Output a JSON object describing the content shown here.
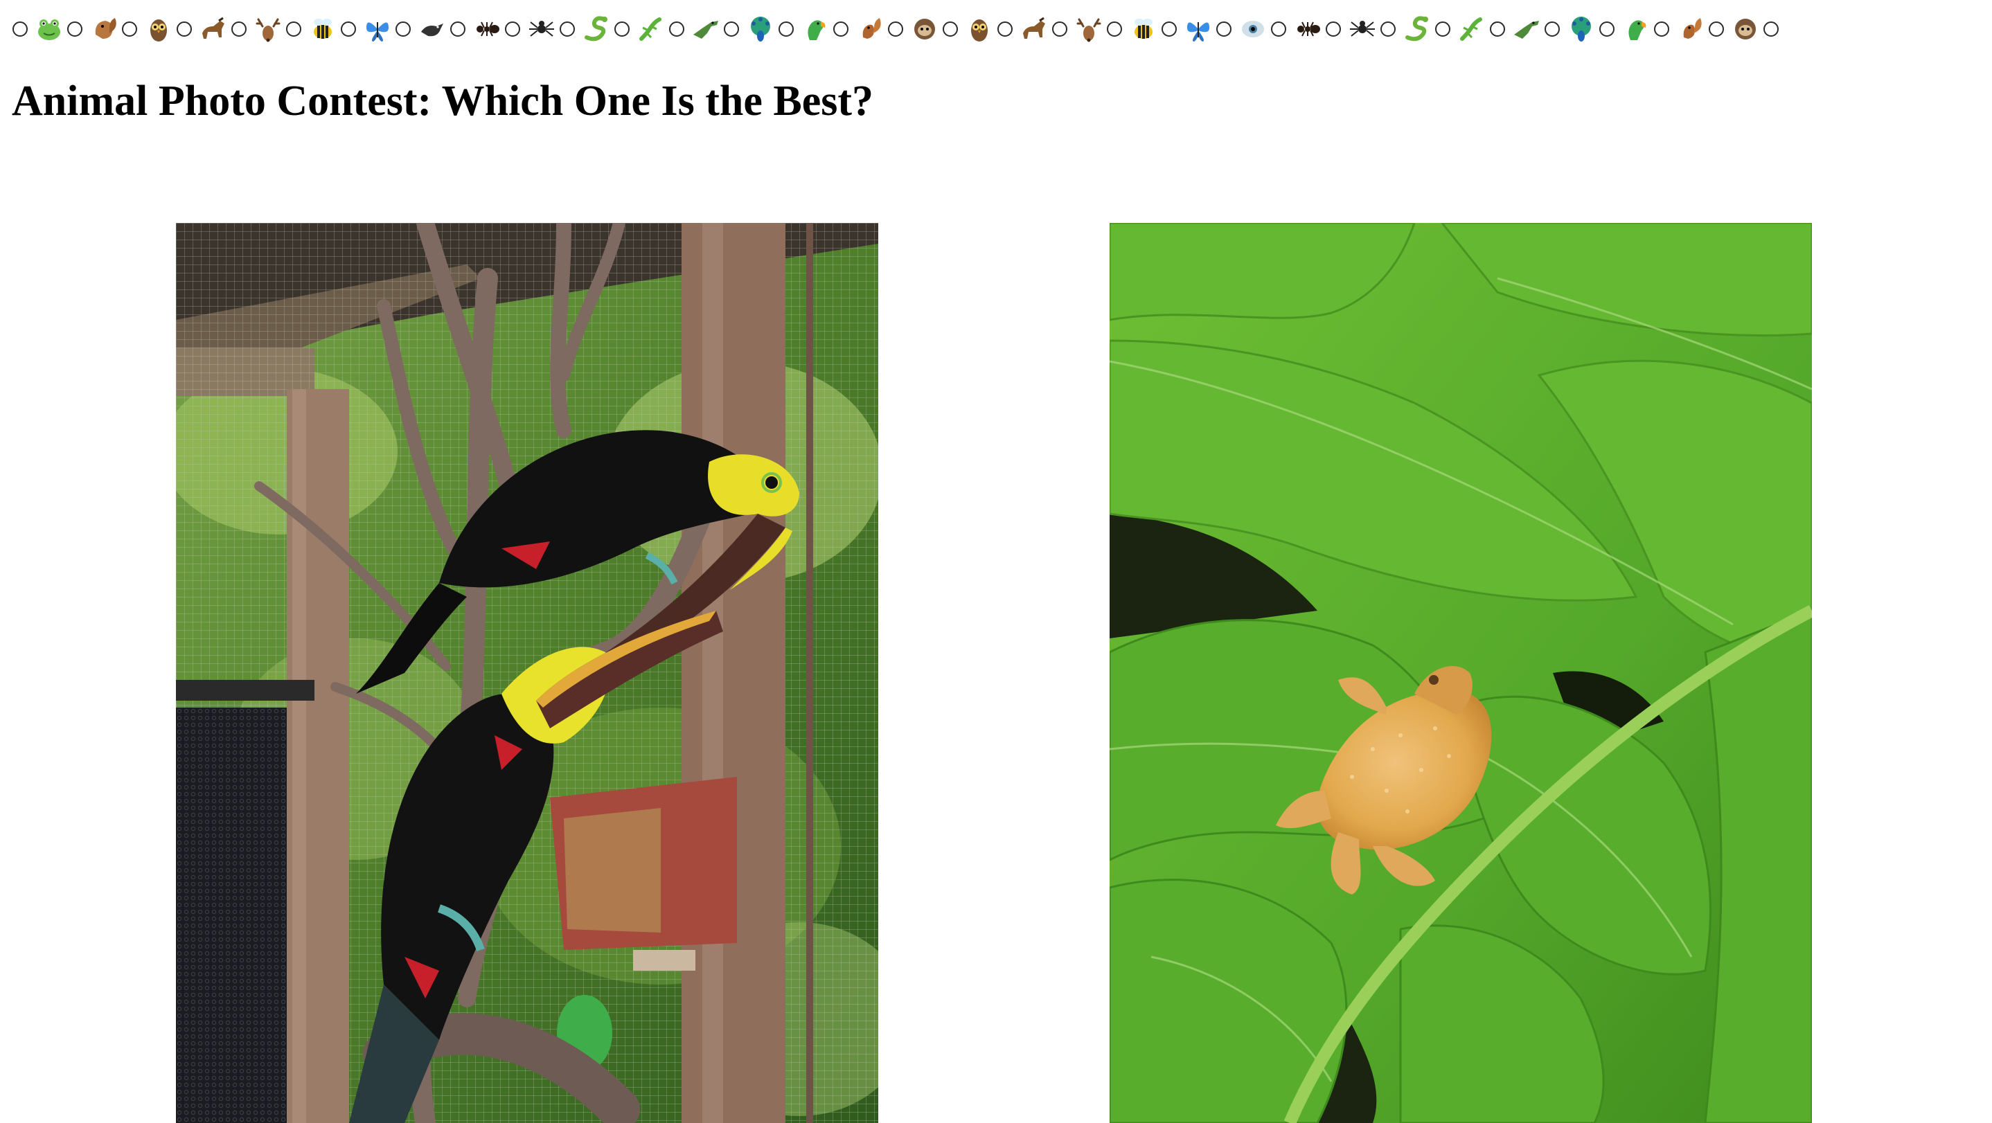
{
  "page": {
    "title": "Animal Photo Contest: Which One Is the Best?"
  },
  "emoji_options": [
    {
      "icon": "frog-icon",
      "glyph": "🐸"
    },
    {
      "icon": "chipmunk-icon",
      "glyph": "🐿"
    },
    {
      "icon": "owl-icon",
      "glyph": "🦉"
    },
    {
      "icon": "horse-icon",
      "glyph": "🐎"
    },
    {
      "icon": "deer-icon",
      "glyph": "🦌"
    },
    {
      "icon": "bee-icon",
      "glyph": "🐝"
    },
    {
      "icon": "butterfly-icon",
      "glyph": "🦋"
    },
    {
      "icon": "bird-icon",
      "glyph": "🐦"
    },
    {
      "icon": "ant-icon",
      "glyph": "🐜"
    },
    {
      "icon": "spider-icon",
      "glyph": "🕷"
    },
    {
      "icon": "snake-icon",
      "glyph": "🐍"
    },
    {
      "icon": "lizard-icon",
      "glyph": "🦎"
    },
    {
      "icon": "crocodile-icon",
      "glyph": "🐊"
    },
    {
      "icon": "peacock-icon",
      "glyph": "🦚"
    },
    {
      "icon": "parrot-icon",
      "glyph": "🦜"
    },
    {
      "icon": "squirrel-icon",
      "glyph": "🐿"
    },
    {
      "icon": "sloth-icon",
      "glyph": "🦥"
    },
    {
      "icon": "owl-icon",
      "glyph": "🦉"
    },
    {
      "icon": "horse-icon",
      "glyph": "🐎"
    },
    {
      "icon": "deer-icon",
      "glyph": "🦌"
    },
    {
      "icon": "bee-icon",
      "glyph": "🐝"
    },
    {
      "icon": "butterfly-icon",
      "glyph": "🦋"
    },
    {
      "icon": "eye-icon",
      "glyph": "👁"
    },
    {
      "icon": "ant-icon",
      "glyph": "🐜"
    },
    {
      "icon": "spider-icon",
      "glyph": "🕷"
    },
    {
      "icon": "snake-icon",
      "glyph": "🐍"
    },
    {
      "icon": "lizard-icon",
      "glyph": "🦎"
    },
    {
      "icon": "crocodile-icon",
      "glyph": "🐊"
    },
    {
      "icon": "peacock-icon",
      "glyph": "🦚"
    },
    {
      "icon": "parrot-icon",
      "glyph": "🦜"
    },
    {
      "icon": "squirrel-icon",
      "glyph": "🐿"
    },
    {
      "icon": "sloth-icon",
      "glyph": "🦥"
    }
  ],
  "colors": {
    "leaf_green": "#5cae2a",
    "leaf_dark": "#3f8a1d",
    "frog_orange": "#e2a84c",
    "toucan_black": "#121212",
    "toucan_yellow": "#e8de2a",
    "wood": "#8a6a55"
  }
}
